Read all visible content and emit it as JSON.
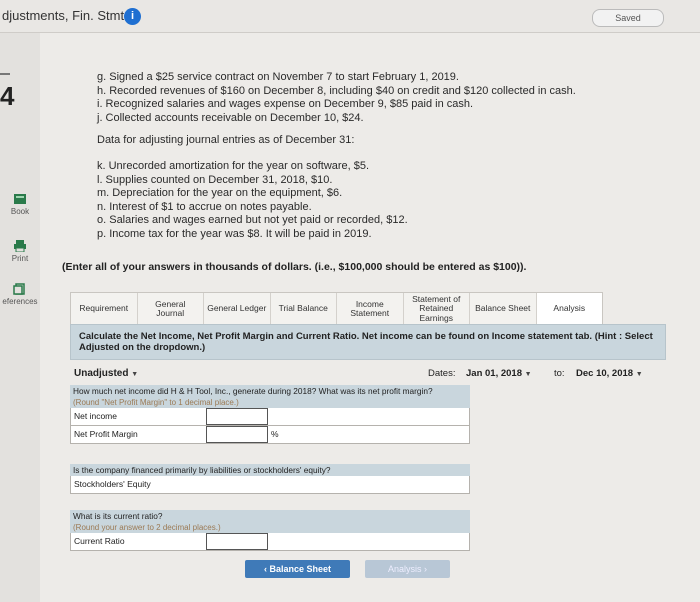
{
  "header": {
    "title": "djustments, Fin. Stmts.",
    "saved": "Saved"
  },
  "rail": {
    "question_number": "4",
    "book": "Book",
    "print": "Print",
    "references": "eferences"
  },
  "transactions": [
    "g. Signed a $25 service contract on November 7 to start February 1, 2019.",
    "h. Recorded revenues of $160 on December 8, including $40 on credit and $120 collected in cash.",
    "i. Recognized salaries and wages expense on December 9, $85 paid in cash.",
    "j. Collected accounts receivable on December 10, $24."
  ],
  "adjusting_header": "Data for adjusting journal entries as of December 31:",
  "adjustments": [
    "k. Unrecorded amortization for the year on software, $5.",
    "l. Supplies counted on December 31, 2018, $10.",
    "m. Depreciation for the year on the equipment, $6.",
    "n. Interest of $1 to accrue on notes payable.",
    "o. Salaries and wages earned but not yet paid or recorded, $12.",
    "p. Income tax for the year was $8. It will be paid in 2019."
  ],
  "instruction": "(Enter all of your answers in thousands of dollars. (i.e., $100,000 should be entered as $100)).",
  "tabs": [
    "Requirement",
    "General Journal",
    "General Ledger",
    "Trial Balance",
    "Income Statement",
    "Statement of Retained Earnings",
    "Balance Sheet",
    "Analysis"
  ],
  "calc_text": "Calculate the Net Income, Net Profit Margin and Current Ratio. Net income can be found on Income statement tab. (Hint : Select Adjusted on the dropdown.)",
  "controls": {
    "view": "Unadjusted",
    "dates_label": "Dates:",
    "from": "Jan 01, 2018",
    "to_label": "to:",
    "to": "Dec 10, 2018"
  },
  "section1": {
    "question": "How much net income did H & H Tool, Inc., generate during 2018? What was its net profit margin?",
    "hint": "(Round \"Net Profit Margin\" to 1 decimal place.)",
    "row1": "Net income",
    "row2": "Net Profit Margin",
    "pct": "%"
  },
  "section2": {
    "question": "Is the company financed primarily by liabilities or stockholders' equity?",
    "row1": "Stockholders' Equity"
  },
  "section3": {
    "question": "What is its current ratio?",
    "hint": "(Round your answer to 2 decimal places.)",
    "row1": "Current Ratio"
  },
  "nav": {
    "back": "Balance Sheet",
    "next": "Analysis"
  }
}
